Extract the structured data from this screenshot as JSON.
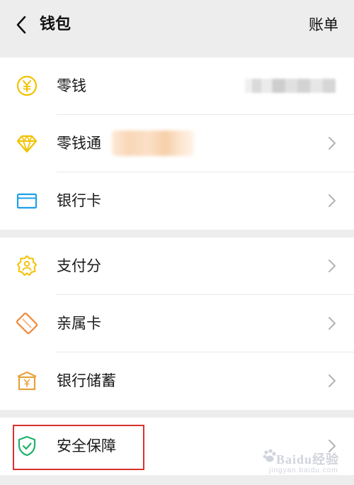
{
  "header": {
    "title": "钱包",
    "action_label": "账单"
  },
  "groups": [
    {
      "items": [
        {
          "label": "零钱",
          "icon": "yuan-coin-icon",
          "color": "#f2c200"
        },
        {
          "label": "零钱通",
          "icon": "diamond-icon",
          "color": "#f2c200"
        },
        {
          "label": "银行卡",
          "icon": "bank-card-icon",
          "color": "#1ea0e6"
        }
      ]
    },
    {
      "items": [
        {
          "label": "支付分",
          "icon": "badge-score-icon",
          "color": "#f2c200"
        },
        {
          "label": "亲属卡",
          "icon": "family-card-icon",
          "color": "#f08a3c"
        },
        {
          "label": "银行储蓄",
          "icon": "bank-building-icon",
          "color": "#e6a23c"
        }
      ]
    },
    {
      "items": [
        {
          "label": "安全保障",
          "icon": "shield-check-icon",
          "color": "#20b36b"
        }
      ]
    }
  ],
  "watermark": {
    "text": "Baidu经验",
    "sub": "jingyan.baidu.com"
  },
  "colors": {
    "background": "#ededed",
    "highlight": "#d9312e"
  }
}
